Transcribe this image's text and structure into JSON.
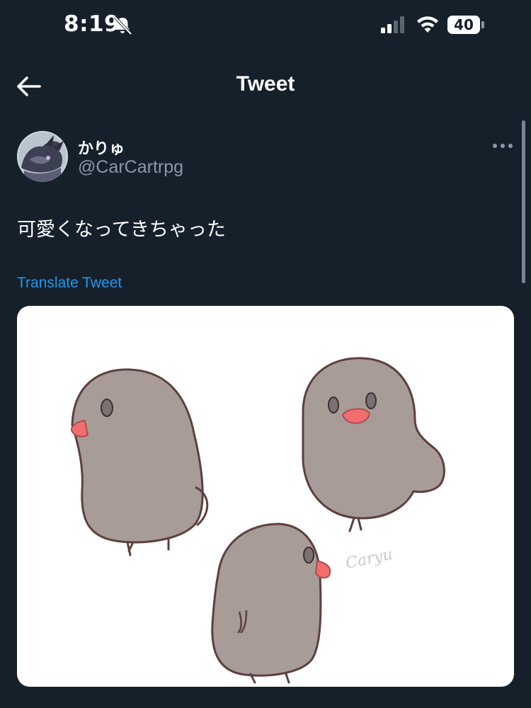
{
  "status_bar": {
    "time": "8:19",
    "battery_level": "40",
    "icons": [
      "bell-slash-icon",
      "cellular-signal-icon",
      "wifi-icon",
      "battery-icon"
    ]
  },
  "nav": {
    "title": "Tweet",
    "back_icon": "arrow-left-icon"
  },
  "tweet": {
    "author": {
      "display_name": "かりゅ",
      "handle": "@CarCartrpg"
    },
    "text": "可愛くなってきちゃった",
    "translate_label": "Translate Tweet",
    "more_icon": "more-horizontal-icon",
    "media": {
      "signature": "Caryu",
      "bg_color": "#ffffff",
      "bird_color": "#a89c99",
      "beak_color": "#f26d6d"
    }
  },
  "colors": {
    "background": "#15202b",
    "accent": "#1d9bf0",
    "secondary_text": "#8b98a5"
  }
}
